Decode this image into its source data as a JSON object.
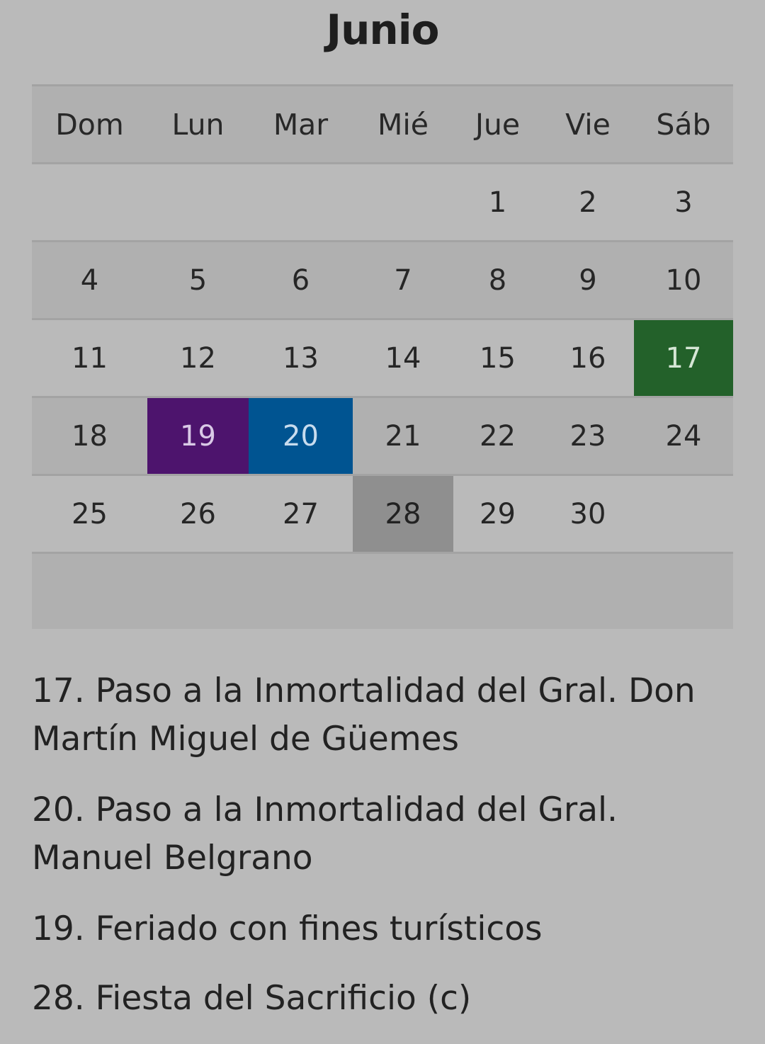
{
  "title": "Junio",
  "weekdays": [
    "Dom",
    "Lun",
    "Mar",
    "Mié",
    "Jue",
    "Vie",
    "Sáb"
  ],
  "weeks": [
    [
      "",
      "",
      "",
      "",
      "1",
      "2",
      "3"
    ],
    [
      "4",
      "5",
      "6",
      "7",
      "8",
      "9",
      "10"
    ],
    [
      "11",
      "12",
      "13",
      "14",
      "15",
      "16",
      "17"
    ],
    [
      "18",
      "19",
      "20",
      "21",
      "22",
      "23",
      "24"
    ],
    [
      "25",
      "26",
      "27",
      "28",
      "29",
      "30",
      ""
    ]
  ],
  "highlight_colors": {
    "17": "#23612a",
    "19": "#4d146d",
    "20": "#005491",
    "28": "#8f8f8f"
  },
  "notes": [
    "17. Paso a la Inmortalidad del Gral. Don Martín Miguel de Güemes",
    "20. Paso a la Inmortalidad del Gral. Manuel Belgrano",
    "19. Feriado con fines turísticos",
    "28. Fiesta del Sacrificio (c)"
  ]
}
